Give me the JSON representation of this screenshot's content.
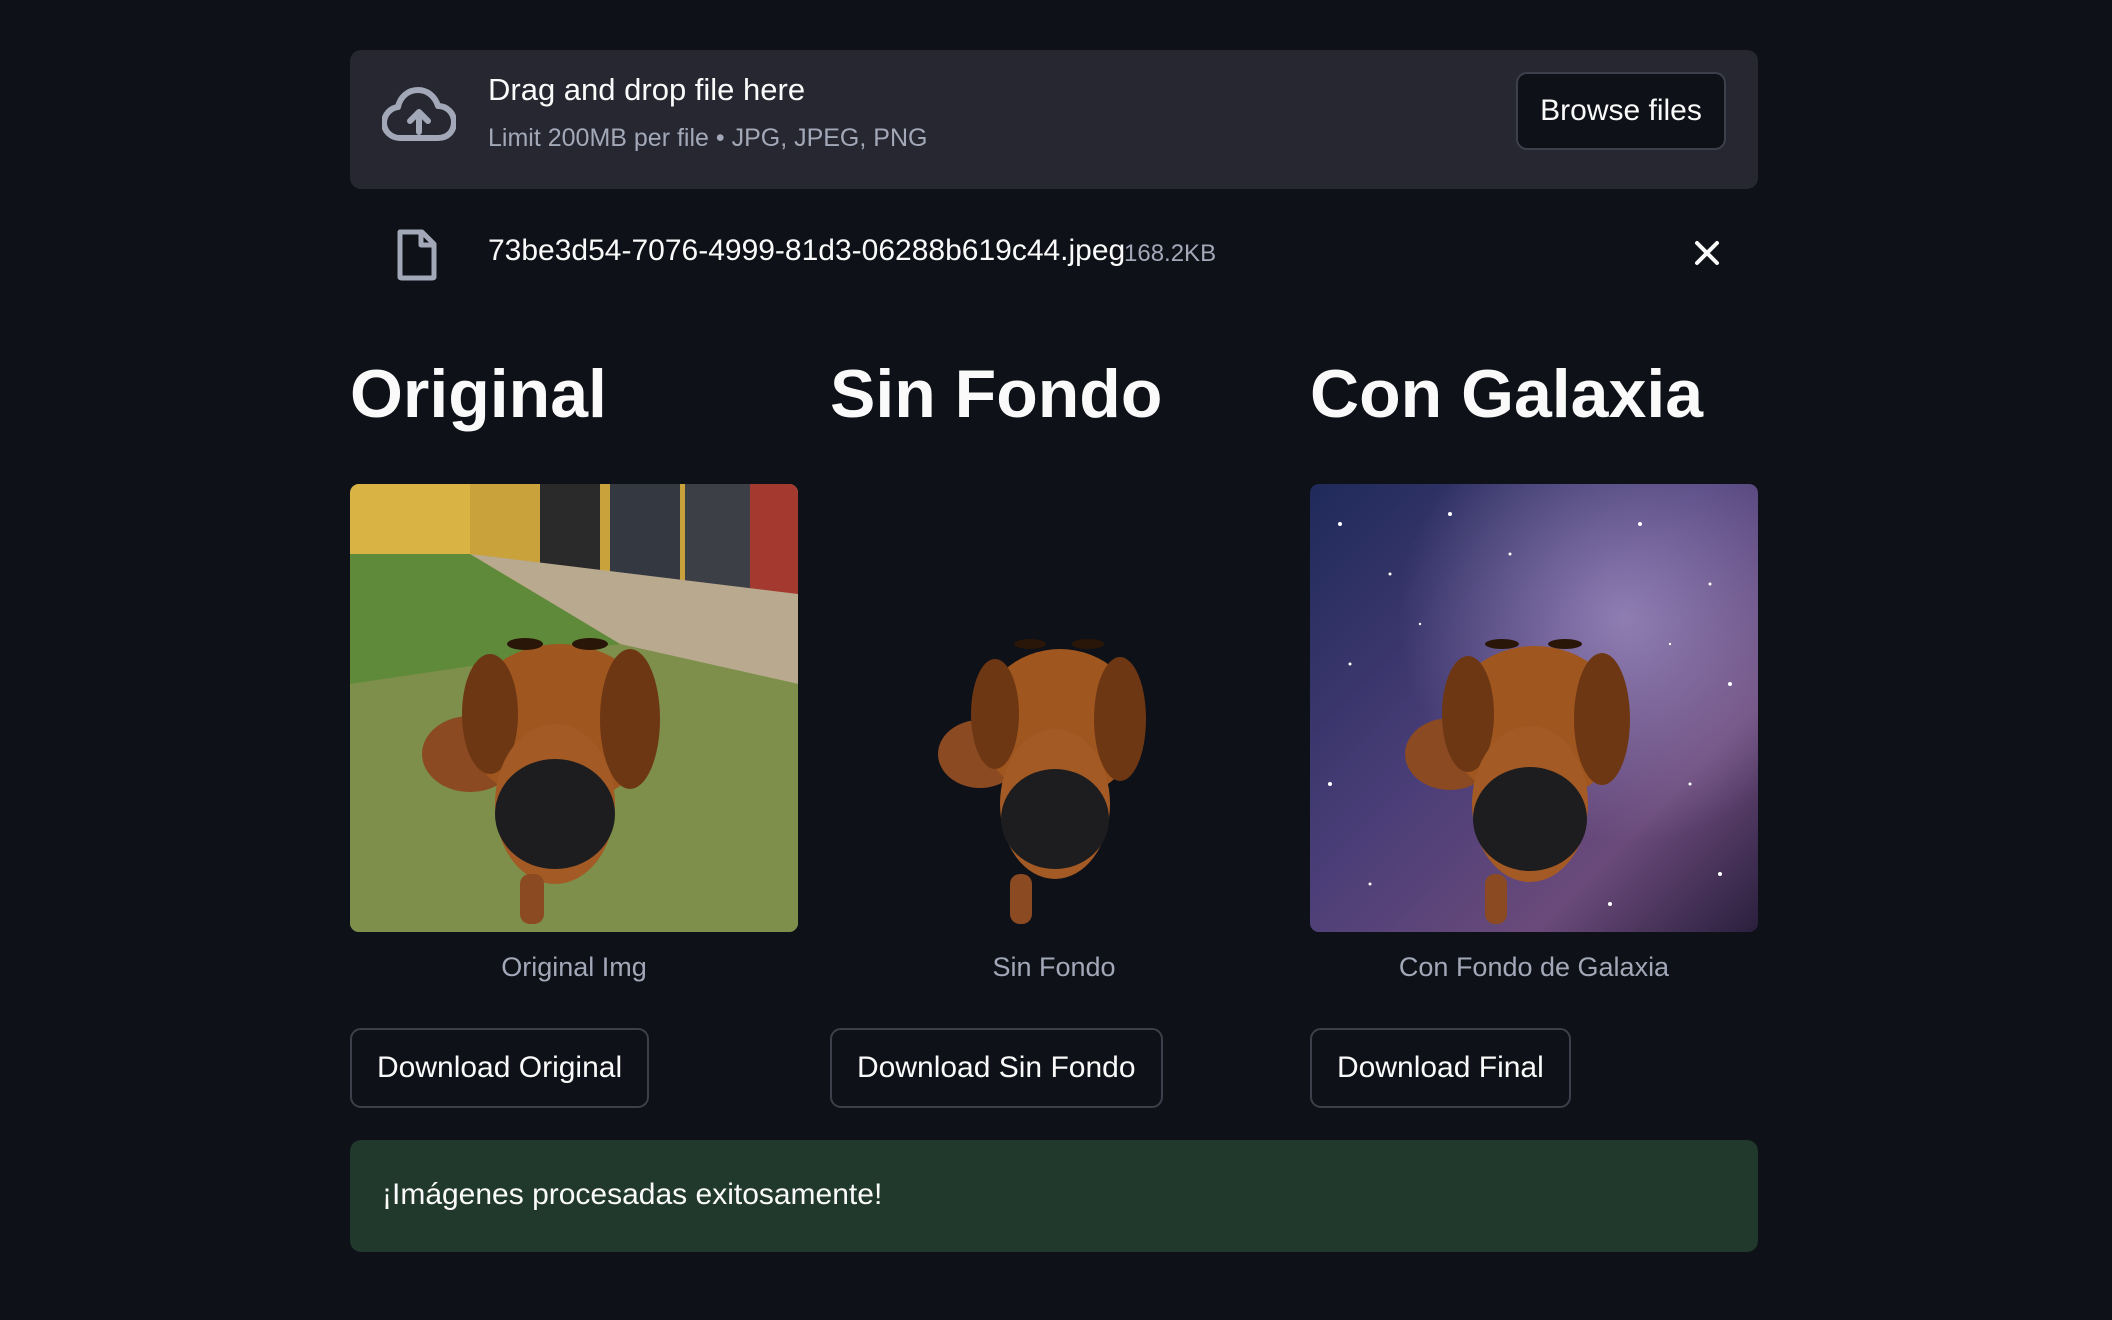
{
  "uploader": {
    "title": "Drag and drop file here",
    "limits": "Limit 200MB per file • JPG, JPEG, PNG",
    "browse_label": "Browse files",
    "icon": "cloud-upload-icon"
  },
  "file": {
    "name": "73be3d54-7076-4999-81d3-06288b619c44.jpeg",
    "size": "168.2KB",
    "icon": "file-icon",
    "remove_icon": "close-icon"
  },
  "columns": [
    {
      "heading": "Original",
      "caption": "Original Img",
      "button": "Download Original"
    },
    {
      "heading": "Sin Fondo",
      "caption": "Sin Fondo",
      "button": "Download Sin Fondo"
    },
    {
      "heading": "Con Galaxia",
      "caption": "Con Fondo de Galaxia",
      "button": "Download Final"
    }
  ],
  "status": {
    "message": "¡Imágenes procesadas exitosamente!"
  },
  "colors": {
    "background": "#0e1117",
    "panel": "#262730",
    "success_bg": "#21382c",
    "muted_text": "#a3a8b8"
  }
}
